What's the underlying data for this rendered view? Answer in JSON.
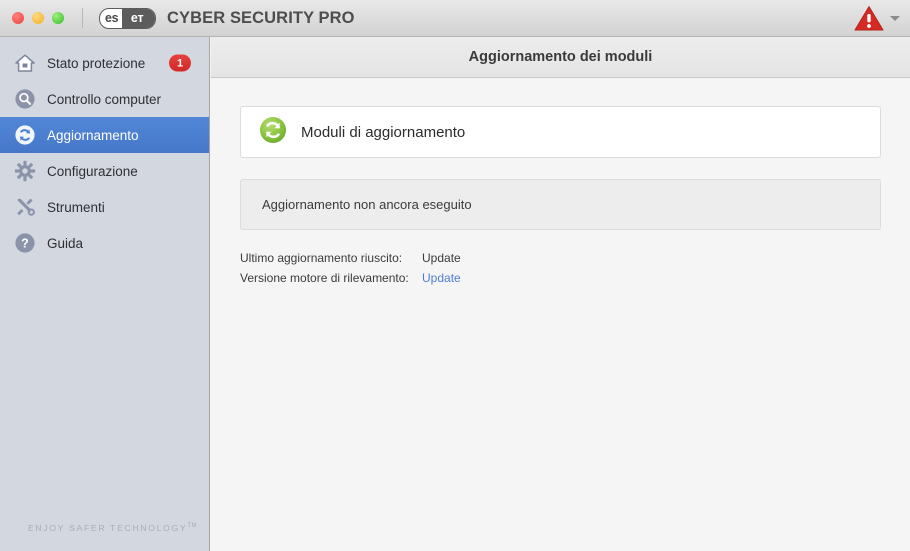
{
  "titlebar": {
    "traffic_lights": [
      {
        "name": "close",
        "color": "#f0574f"
      },
      {
        "name": "minimize",
        "color": "#f6bd3f"
      },
      {
        "name": "zoom",
        "color": "#52cc44"
      }
    ],
    "logo_left": "es",
    "logo_right": "eт",
    "product_name": "CYBER SECURITY PRO",
    "status_icon": "warning-triangle-icon",
    "status_icon_color": "#d32b24",
    "menu_icon": "chevron-down-icon"
  },
  "sidebar": {
    "background": "#d3d7e0",
    "selected_color": "#4a7fd0",
    "items": [
      {
        "icon": "home-icon",
        "label": "Stato protezione",
        "badge": "1",
        "selected": false
      },
      {
        "icon": "search-icon",
        "label": "Controllo computer",
        "badge": "",
        "selected": false
      },
      {
        "icon": "refresh-icon",
        "label": "Aggiornamento",
        "badge": "",
        "selected": true
      },
      {
        "icon": "gear-icon",
        "label": "Configurazione",
        "badge": "",
        "selected": false
      },
      {
        "icon": "tools-icon",
        "label": "Strumenti",
        "badge": "",
        "selected": false
      },
      {
        "icon": "help-icon",
        "label": "Guida",
        "badge": "",
        "selected": false
      }
    ],
    "tagline": "ENJOY SAFER TECHNOLOGY",
    "tagline_mark": "TM"
  },
  "main": {
    "title": "Aggiornamento dei moduli",
    "update_panel": {
      "icon": "update-modules-icon",
      "icon_color": "#7ab648",
      "title": "Moduli di aggiornamento"
    },
    "status_panel": {
      "text": "Aggiornamento non ancora eseguito"
    },
    "info_rows": [
      {
        "label": "Ultimo aggiornamento riuscito:",
        "value": "Update",
        "is_link": false
      },
      {
        "label": "Versione motore di rilevamento:",
        "value": "Update",
        "is_link": true
      }
    ]
  }
}
